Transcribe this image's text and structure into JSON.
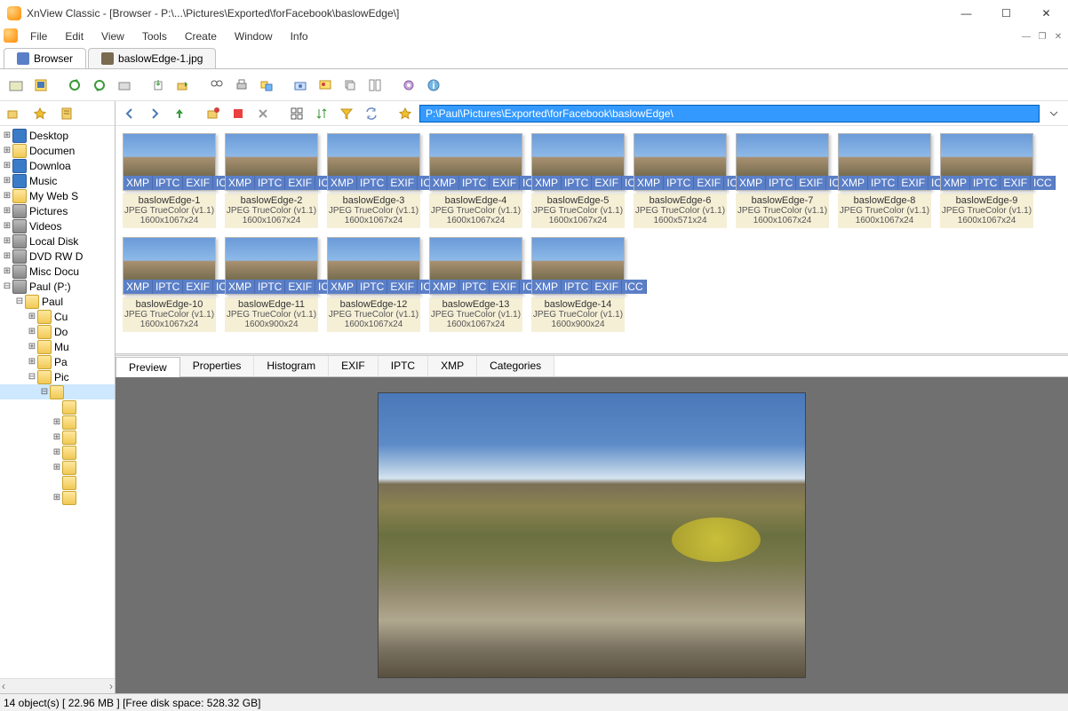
{
  "title": "XnView Classic - [Browser - P:\\...\\Pictures\\Exported\\forFacebook\\baslowEdge\\]",
  "menu": {
    "file": "File",
    "edit": "Edit",
    "view": "View",
    "tools": "Tools",
    "create": "Create",
    "window": "Window",
    "info": "Info"
  },
  "tabs": {
    "browser": "Browser",
    "img": "baslowEdge-1.jpg"
  },
  "path": "P:\\Paul\\Pictures\\Exported\\forFacebook\\baslowEdge\\",
  "tree": [
    {
      "exp": "⊞",
      "label": "Desktop",
      "icon": "desktop",
      "depth": 0
    },
    {
      "exp": "⊞",
      "label": "Documen",
      "icon": "folder",
      "depth": 0
    },
    {
      "exp": "⊞",
      "label": "Downloa",
      "icon": "download",
      "depth": 0
    },
    {
      "exp": "⊞",
      "label": "Music",
      "icon": "music",
      "depth": 0
    },
    {
      "exp": "⊞",
      "label": "My Web S",
      "icon": "folder",
      "depth": 0
    },
    {
      "exp": "⊞",
      "label": "Pictures",
      "icon": "pictures",
      "depth": 0
    },
    {
      "exp": "⊞",
      "label": "Videos",
      "icon": "videos",
      "depth": 0
    },
    {
      "exp": "⊞",
      "label": "Local Disk",
      "icon": "drive",
      "depth": 0
    },
    {
      "exp": "⊞",
      "label": "DVD RW D",
      "icon": "dvd",
      "depth": 0
    },
    {
      "exp": "⊞",
      "label": "Misc Docu",
      "icon": "drive",
      "depth": 0
    },
    {
      "exp": "⊟",
      "label": "Paul (P:)",
      "icon": "drive",
      "depth": 0
    },
    {
      "exp": "⊟",
      "label": "Paul",
      "icon": "folder",
      "depth": 1
    },
    {
      "exp": "⊞",
      "label": "Cu",
      "icon": "folder",
      "depth": 2
    },
    {
      "exp": "⊞",
      "label": "Do",
      "icon": "folder",
      "depth": 2
    },
    {
      "exp": "⊞",
      "label": "Mu",
      "icon": "folder",
      "depth": 2
    },
    {
      "exp": "⊞",
      "label": "Pa",
      "icon": "folder",
      "depth": 2
    },
    {
      "exp": "⊟",
      "label": "Pic",
      "icon": "folder",
      "depth": 2
    },
    {
      "exp": "⊟",
      "label": "",
      "icon": "folder",
      "depth": 3,
      "selected": true
    },
    {
      "exp": "",
      "label": "",
      "icon": "",
      "depth": 4
    },
    {
      "exp": "⊞",
      "label": "",
      "icon": "",
      "depth": 4
    },
    {
      "exp": "⊞",
      "label": "",
      "icon": "",
      "depth": 4
    },
    {
      "exp": "⊞",
      "label": "",
      "icon": "",
      "depth": 4
    },
    {
      "exp": "⊞",
      "label": "",
      "icon": "",
      "depth": 4
    },
    {
      "exp": "",
      "label": "",
      "icon": "",
      "depth": 4
    },
    {
      "exp": "⊞",
      "label": "",
      "icon": "",
      "depth": 4
    }
  ],
  "badges": [
    "XMP",
    "IPTC",
    "EXIF",
    "ICC"
  ],
  "thumbs": [
    {
      "name": "baslowEdge-1",
      "type": "JPEG TrueColor (v1.1)",
      "dim": "1600x1067x24"
    },
    {
      "name": "baslowEdge-2",
      "type": "JPEG TrueColor (v1.1)",
      "dim": "1600x1067x24"
    },
    {
      "name": "baslowEdge-3",
      "type": "JPEG TrueColor (v1.1)",
      "dim": "1600x1067x24"
    },
    {
      "name": "baslowEdge-4",
      "type": "JPEG TrueColor (v1.1)",
      "dim": "1600x1067x24"
    },
    {
      "name": "baslowEdge-5",
      "type": "JPEG TrueColor (v1.1)",
      "dim": "1600x1067x24"
    },
    {
      "name": "baslowEdge-6",
      "type": "JPEG TrueColor (v1.1)",
      "dim": "1600x571x24"
    },
    {
      "name": "baslowEdge-7",
      "type": "JPEG TrueColor (v1.1)",
      "dim": "1600x1067x24"
    },
    {
      "name": "baslowEdge-8",
      "type": "JPEG TrueColor (v1.1)",
      "dim": "1600x1067x24"
    },
    {
      "name": "baslowEdge-9",
      "type": "JPEG TrueColor (v1.1)",
      "dim": "1600x1067x24"
    },
    {
      "name": "baslowEdge-10",
      "type": "JPEG TrueColor (v1.1)",
      "dim": "1600x1067x24"
    },
    {
      "name": "baslowEdge-11",
      "type": "JPEG TrueColor (v1.1)",
      "dim": "1600x900x24"
    },
    {
      "name": "baslowEdge-12",
      "type": "JPEG TrueColor (v1.1)",
      "dim": "1600x1067x24"
    },
    {
      "name": "baslowEdge-13",
      "type": "JPEG TrueColor (v1.1)",
      "dim": "1600x1067x24"
    },
    {
      "name": "baslowEdge-14",
      "type": "JPEG TrueColor (v1.1)",
      "dim": "1600x900x24"
    }
  ],
  "info_tabs": {
    "preview": "Preview",
    "properties": "Properties",
    "histogram": "Histogram",
    "exif": "EXIF",
    "iptc": "IPTC",
    "xmp": "XMP",
    "categories": "Categories"
  },
  "status": "14 object(s) [ 22.96 MB ] [Free disk space: 528.32 GB]"
}
